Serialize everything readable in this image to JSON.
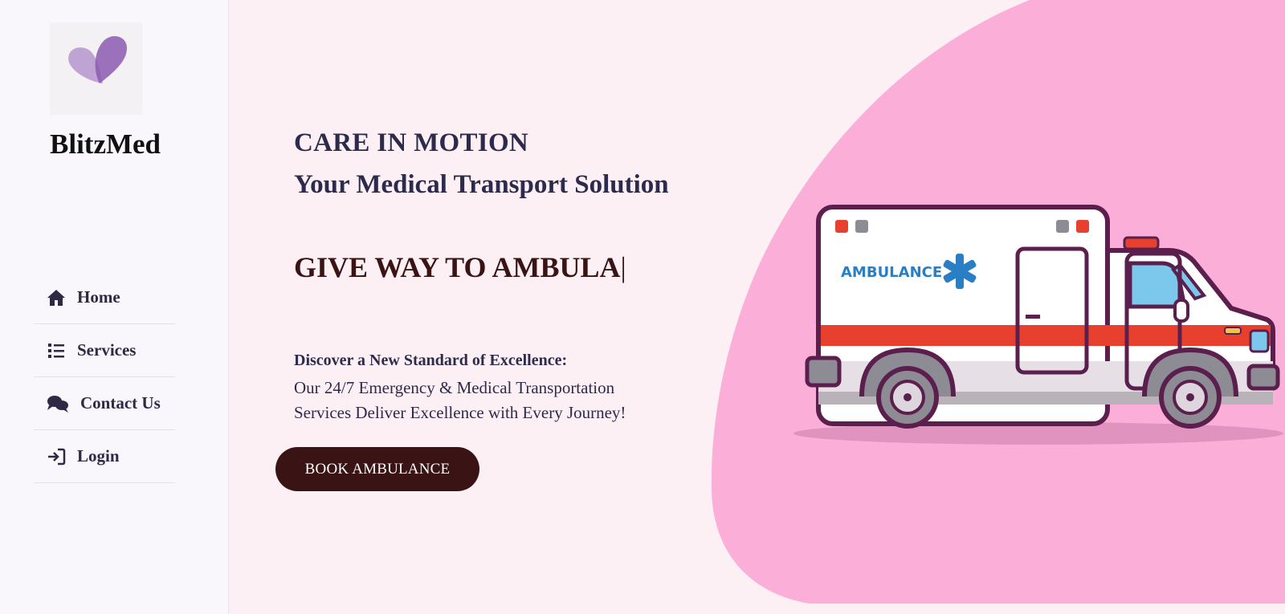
{
  "brand": {
    "name": "BlitzMed",
    "logo_icon": "heart-logo-icon"
  },
  "nav": {
    "items": [
      {
        "label": "Home",
        "icon": "home-icon"
      },
      {
        "label": "Services",
        "icon": "list-icon"
      },
      {
        "label": "Contact Us",
        "icon": "chat-bubbles-icon"
      },
      {
        "label": "Login",
        "icon": "login-icon"
      }
    ]
  },
  "hero": {
    "tagline": "CARE IN MOTION",
    "subtitle": "Your Medical Transport Solution",
    "typing_text": "GIVE WAY TO AMBULA",
    "typing_cursor": "|",
    "discover_title": "Discover a New Standard of Excellence:",
    "description": "Our 24/7 Emergency & Medical Transportation Services Deliver Excellence with Every Journey!",
    "cta_label": "BOOK AMBULANCE"
  },
  "illustration": {
    "vehicle_label": "AMBULANCE",
    "icon": "ambulance-illustration"
  },
  "colors": {
    "page_bg": "#fdf0f5",
    "sidebar_bg": "#f9f6fc",
    "blob": "#fbafd8",
    "heading": "#2d2b4d",
    "accent_dark": "#3a1414",
    "logo_purple": "#8c5bb0"
  }
}
